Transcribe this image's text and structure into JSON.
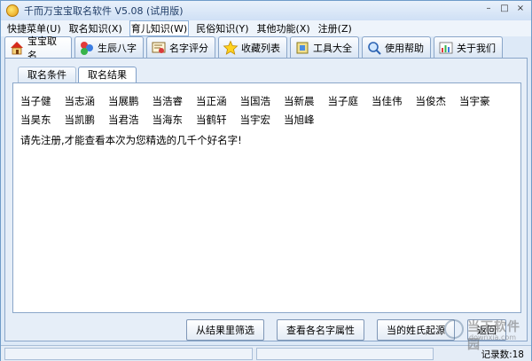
{
  "window": {
    "title": "千而万宝宝取名软件 V5.08 (试用版)"
  },
  "window_controls": {
    "minimize": "–",
    "maximize": "□",
    "close": "×"
  },
  "menubar": {
    "items": [
      "快捷菜单(U)",
      "取名知识(X)",
      "育儿知识(W)",
      "民俗知识(Y)",
      "其他功能(X)",
      "注册(Z)"
    ],
    "active_index": 2
  },
  "main_tabs": [
    "宝宝取名",
    "生辰八字",
    "名字评分",
    "收藏列表",
    "工具大全",
    "使用帮助",
    "关于我们"
  ],
  "sub_tabs": [
    "取名条件",
    "取名结果"
  ],
  "results": {
    "names": [
      "当子健",
      "当志涵",
      "当展鹏",
      "当浩睿",
      "当正涵",
      "当国浩",
      "当新晨",
      "当子庭",
      "当佳伟",
      "当俊杰",
      "当宇豪",
      "当昊东",
      "当凯鹏",
      "当君浩",
      "当海东",
      "当鹤轩",
      "当宇宏",
      "当旭峰"
    ],
    "notice": "请先注册,才能查看本次为您精选的几千个好名字!"
  },
  "buttons": {
    "filter": "从结果里筛选",
    "attributes": "查看各名字属性",
    "origin": "当的姓氏起源",
    "back": "返回"
  },
  "status": {
    "record_count": "记录数:18"
  },
  "watermark": {
    "text": "当下软件园",
    "url": "downxia.com"
  },
  "colors": {
    "border": "#8aa6c9",
    "panel_bg": "#e6eef8",
    "title_bar": "#cfe0f5"
  }
}
